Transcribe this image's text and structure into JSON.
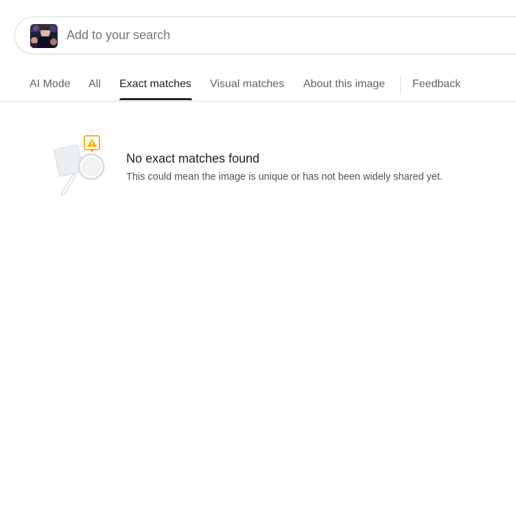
{
  "search": {
    "placeholder": "Add to your search",
    "value": ""
  },
  "tabs": [
    {
      "label": "AI Mode"
    },
    {
      "label": "All"
    },
    {
      "label": "Exact matches",
      "active": true
    },
    {
      "label": "Visual matches"
    },
    {
      "label": "About this image"
    },
    {
      "label": "Feedback"
    }
  ],
  "empty_state": {
    "title": "No exact matches found",
    "description": "This could mean the image is unique or has not been widely shared yet."
  },
  "colors": {
    "warning": "#f9ab00",
    "text_primary": "#202124",
    "text_secondary": "#5f6368",
    "border": "#dadce0"
  },
  "icons": {
    "thumbnail": "image-thumbnail",
    "illustration": "magnifier-warning-icon"
  }
}
